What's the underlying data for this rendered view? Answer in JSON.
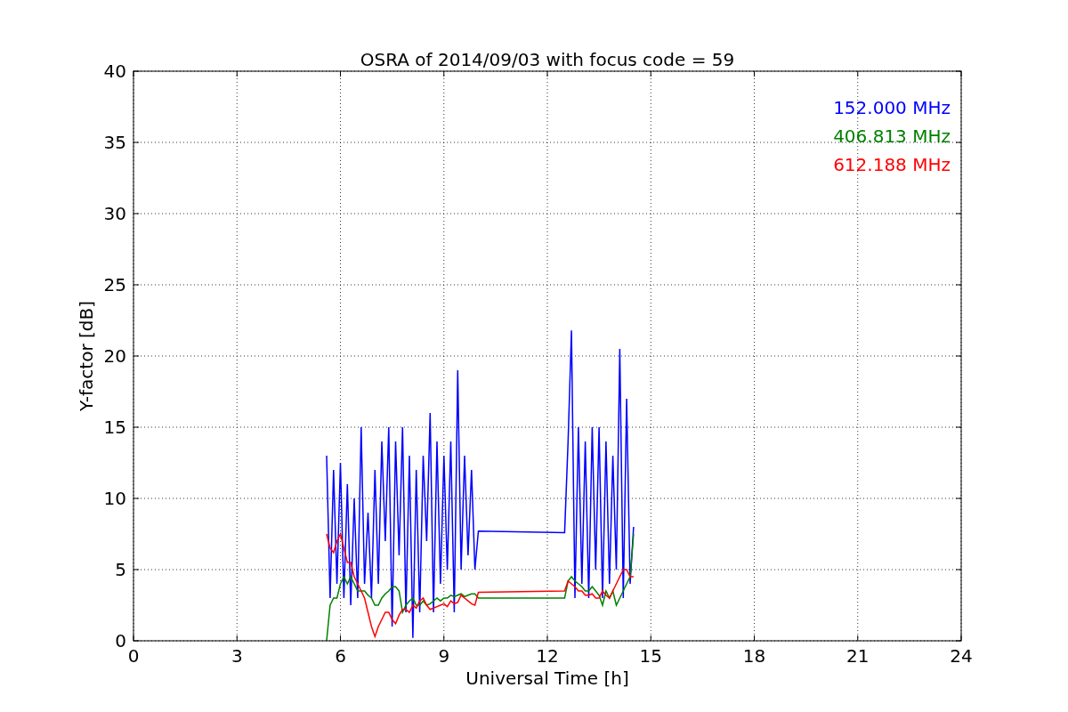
{
  "figure": {
    "chart_data": {
      "type": "line",
      "grid": true,
      "title": "OSRA of 2014/09/03 with focus code = 59",
      "xlabel": "Universal Time [h]",
      "ylabel": "Y-factor [dB]",
      "xlim": [
        0,
        24
      ],
      "ylim": [
        0,
        40
      ],
      "xticks": [
        0,
        3,
        6,
        9,
        12,
        15,
        18,
        21,
        24
      ],
      "yticks": [
        0,
        5,
        10,
        15,
        20,
        25,
        30,
        35,
        40
      ],
      "x": [
        5.6,
        5.7,
        5.8,
        5.9,
        6.0,
        6.1,
        6.2,
        6.3,
        6.4,
        6.5,
        6.6,
        6.7,
        6.8,
        6.9,
        7.0,
        7.1,
        7.2,
        7.3,
        7.4,
        7.5,
        7.6,
        7.7,
        7.8,
        7.9,
        8.0,
        8.1,
        8.2,
        8.3,
        8.4,
        8.5,
        8.6,
        8.7,
        8.8,
        8.9,
        9.0,
        9.1,
        9.2,
        9.3,
        9.4,
        9.5,
        9.6,
        9.7,
        9.8,
        9.9,
        10.0,
        12.5,
        12.6,
        12.7,
        12.8,
        12.9,
        13.0,
        13.1,
        13.2,
        13.3,
        13.4,
        13.5,
        13.6,
        13.7,
        13.8,
        13.9,
        14.0,
        14.1,
        14.2,
        14.3,
        14.4,
        14.5
      ],
      "series": [
        {
          "name": "152.000 MHz",
          "color": "#0000ff",
          "values": [
            13,
            3,
            12,
            4,
            12.5,
            3,
            11,
            2.5,
            10,
            3,
            15,
            4,
            9,
            3,
            12,
            4,
            14,
            7,
            15,
            1,
            14,
            6,
            15,
            2,
            13,
            0.2,
            12,
            2,
            13,
            7,
            16,
            2,
            14,
            4,
            13,
            5,
            14,
            2,
            19,
            5,
            13,
            6,
            12,
            5,
            7.7,
            7.6,
            14,
            21.8,
            3,
            15,
            4,
            14,
            3,
            15,
            5,
            15,
            3,
            14,
            4,
            13,
            5,
            20.5,
            3,
            17,
            4,
            8
          ]
        },
        {
          "name": "406.813 MHz",
          "color": "#008000",
          "values": [
            0,
            2.5,
            3,
            3,
            4,
            4.5,
            4,
            4.5,
            4,
            3.5,
            3.5,
            3.5,
            3.2,
            3,
            2.5,
            2.5,
            3,
            3.3,
            3.5,
            3.8,
            3.8,
            3.5,
            2,
            2.5,
            2.8,
            3,
            2.5,
            2.5,
            2.8,
            2.5,
            2.6,
            2.8,
            3,
            2.8,
            3,
            3,
            3.2,
            3.1,
            3.2,
            3.3,
            3.1,
            3.2,
            3.3,
            3.3,
            3,
            3,
            4.2,
            4.5,
            4.2,
            4,
            3.8,
            3.5,
            3.5,
            3.8,
            3.5,
            3.2,
            2.5,
            3.5,
            3,
            3.5,
            2.5,
            3,
            3.5,
            4,
            4.5,
            7.5
          ]
        },
        {
          "name": "612.188 MHz",
          "color": "#ff0000",
          "values": [
            7.5,
            6.5,
            6.2,
            7,
            7.5,
            6.5,
            5.5,
            5.5,
            4.5,
            4,
            3.5,
            3,
            2,
            1,
            0.3,
            1,
            1.5,
            2,
            2,
            1.5,
            1.2,
            1.8,
            2.2,
            2.2,
            2,
            2.5,
            2.3,
            2.8,
            3,
            2.5,
            2.2,
            2.3,
            2.4,
            2.5,
            2.6,
            2.4,
            2.8,
            2.6,
            2.7,
            3.2,
            3,
            2.8,
            2.6,
            2.5,
            3.4,
            3.5,
            4.2,
            4,
            3.8,
            3.5,
            3.5,
            3.2,
            3.2,
            3.3,
            3,
            3,
            3.5,
            3.2,
            3,
            3.5,
            4,
            4.5,
            5,
            5,
            4.5,
            4.5
          ]
        }
      ]
    }
  }
}
